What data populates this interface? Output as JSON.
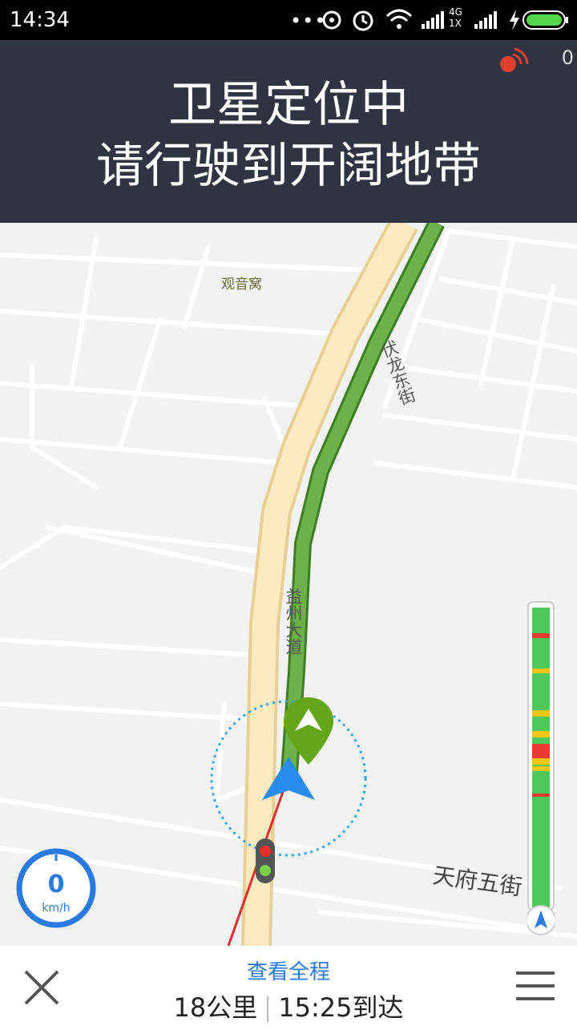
{
  "status_bar": {
    "time": "14:34",
    "network_type": "4G",
    "network_sub": "1X"
  },
  "banner": {
    "line1": "卫星定位中",
    "line2": "请行驶到开阔地带",
    "gps_count": "0"
  },
  "map": {
    "poi": "观音窝",
    "road_fulong": "伏龙东街",
    "road_yizhou": "益州大道",
    "road_tianfu": "天府五街"
  },
  "speed": {
    "value": "0",
    "unit": "km/h"
  },
  "bottom": {
    "route_link": "查看全程",
    "distance": "18公里",
    "arrival": "15:25到达"
  },
  "colors": {
    "banner_bg": "#2f3342",
    "accent": "#2a7ae2",
    "route_green": "#5a9e3a"
  }
}
